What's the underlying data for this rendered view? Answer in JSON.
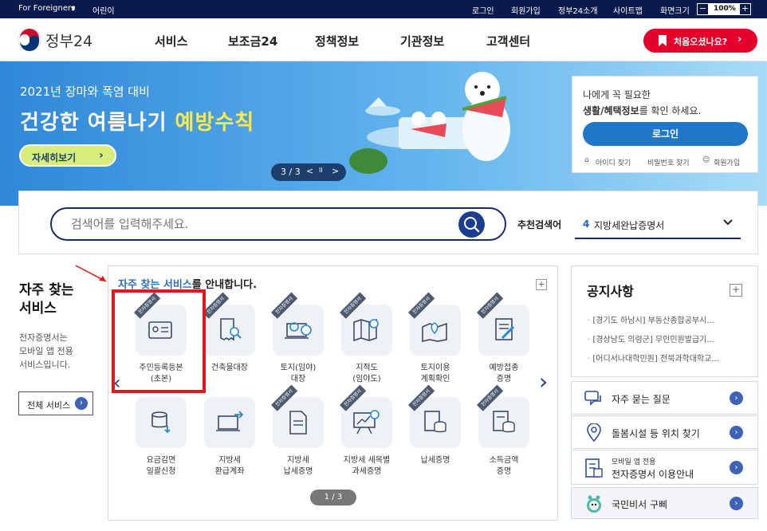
{
  "topbar": {
    "foreigners": "For Foreigners",
    "kids": "어린이",
    "login": "로그인",
    "join": "회원가입",
    "intro": "정부24소개",
    "sitemap": "사이트맵",
    "font_size": "화면크기",
    "zoom_minus": "−",
    "zoom_value": "100%",
    "zoom_plus": "+"
  },
  "header": {
    "logo": "정부24",
    "nav": [
      "서비스",
      "보조금24",
      "정책정보",
      "기관정보",
      "고객센터"
    ],
    "first_visit": "처음오셨나요?"
  },
  "hero": {
    "subtitle": "2021년 장마와 폭염 대비",
    "title_main": "건강한 여름나기 ",
    "title_accent": "예방수칙",
    "more": "자세히보기",
    "slide": "3 / 3",
    "prev": "<",
    "pause": "II",
    "next": ">"
  },
  "login_box": {
    "line1": "나에게 꼭 필요한",
    "line2_bold": "생활/혜택정보",
    "line2_rest": "를 확인 하세요.",
    "button": "로그인",
    "find_id": "아이디 찾기",
    "find_pw": "비밀번호 찾기",
    "join": "회원가입"
  },
  "search": {
    "placeholder": "검색어를 입력해주세요.",
    "recommend_label": "추천검색어",
    "recommend_num": "4",
    "recommend_value": "지방세완납증명서"
  },
  "frequent": {
    "title_line1": "자주 찾는",
    "title_line2": "서비스",
    "desc1": "전자증명서는",
    "desc2": "모바일 앱 전용",
    "desc3": "서비스입니다.",
    "all_button": "전체 서비스"
  },
  "services": {
    "head_highlight": "자주 찾는 서비스",
    "head_rest": "를 안내합니다.",
    "ribbon": "전자증명서",
    "row1": [
      {
        "l1": "주민등록등본",
        "l2": "(초본)"
      },
      {
        "l1": "건축물대장",
        "l2": ""
      },
      {
        "l1": "토지(임야)",
        "l2": "대장"
      },
      {
        "l1": "지적도",
        "l2": "(임야도)"
      },
      {
        "l1": "토지이용",
        "l2": "계획확인"
      },
      {
        "l1": "예방접종",
        "l2": "증명"
      }
    ],
    "row2": [
      {
        "l1": "요금감면",
        "l2": "일괄신청"
      },
      {
        "l1": "지방세",
        "l2": "환급계좌"
      },
      {
        "l1": "지방세",
        "l2": "납세증명"
      },
      {
        "l1": "지방세 세목별",
        "l2": "과세증명"
      },
      {
        "l1": "납세증명",
        "l2": ""
      },
      {
        "l1": "소득금액",
        "l2": "증명"
      }
    ],
    "pager": "1 / 3"
  },
  "notice": {
    "title": "공지사항",
    "items": [
      "[경기도 하남시] 부동산종합공부시...",
      "[경상남도 의령군] 무인민원발급기...",
      "[어디서나대학민원] 전북과학대학교..."
    ]
  },
  "quick_links": {
    "faq": "자주 묻는 질문",
    "care": "돌봄시설 등 위치 찾기",
    "mobile_small": "모바일 앱 전용",
    "mobile_main": "전자증명서 이용안내",
    "gupp": "국민비서 구삐"
  }
}
